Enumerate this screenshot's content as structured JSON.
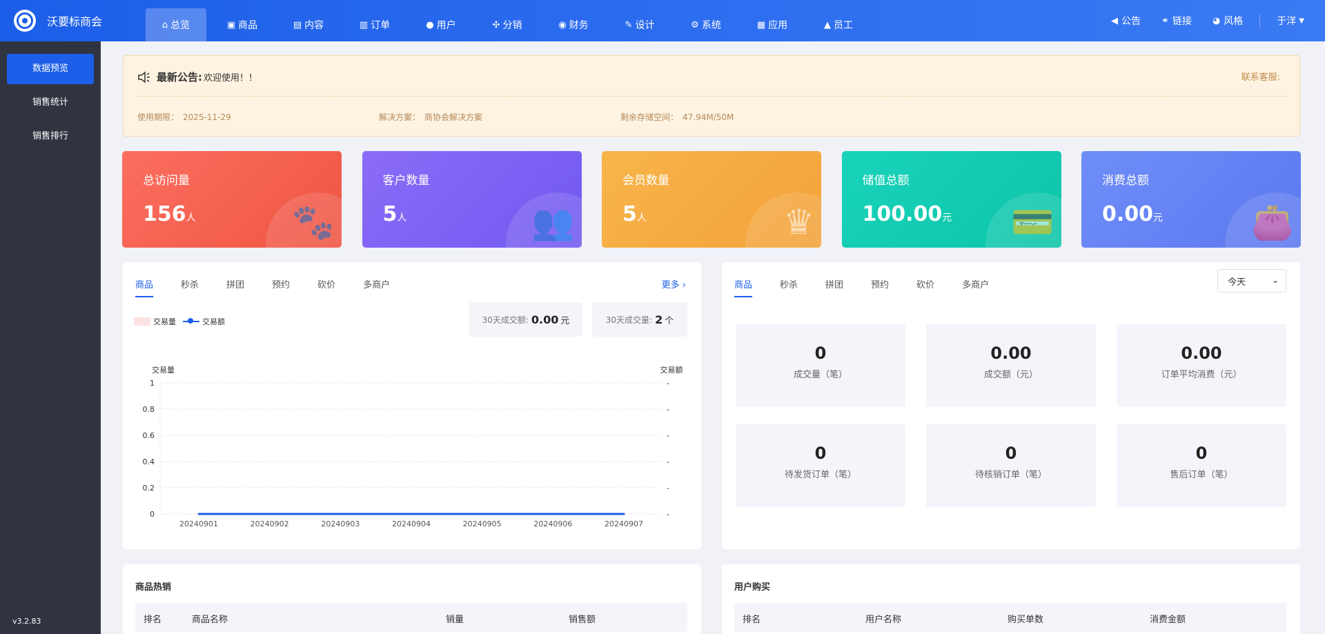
{
  "brand": {
    "name": "沃要标商会"
  },
  "nav": [
    {
      "label": "总览",
      "icon": "⌂",
      "icon_name": "home-icon",
      "active": true
    },
    {
      "label": "商品",
      "icon": "▣",
      "icon_name": "bag-icon"
    },
    {
      "label": "内容",
      "icon": "▤",
      "icon_name": "document-icon"
    },
    {
      "label": "订单",
      "icon": "▥",
      "icon_name": "clipboard-icon"
    },
    {
      "label": "用户",
      "icon": "●",
      "icon_name": "user-icon"
    },
    {
      "label": "分销",
      "icon": "✣",
      "icon_name": "network-icon"
    },
    {
      "label": "财务",
      "icon": "◉",
      "icon_name": "money-bag-icon"
    },
    {
      "label": "设计",
      "icon": "✎",
      "icon_name": "brush-icon"
    },
    {
      "label": "系统",
      "icon": "⚙",
      "icon_name": "gear-icon"
    },
    {
      "label": "应用",
      "icon": "▦",
      "icon_name": "grid-icon"
    },
    {
      "label": "员工",
      "icon": "▲",
      "icon_name": "lock-icon"
    }
  ],
  "topright": {
    "notice": "公告",
    "link": "链接",
    "style": "风格",
    "user": "于洋"
  },
  "sidebar": {
    "items": [
      "数据预览",
      "销售统计",
      "销售排行"
    ],
    "version": "v3.2.83"
  },
  "notice": {
    "title": "最新公告:",
    "text": "欢迎使用！！",
    "contact": "联系客服:",
    "expire_label": "使用期限：",
    "expire_value": "2025-11-29",
    "solution_label": "解决方案：",
    "solution_value": "商协会解决方案",
    "storage_label": "剩余存储空间：",
    "storage_value": "47.94M/50M"
  },
  "stats": [
    {
      "title": "总访问量",
      "value": "156",
      "unit": "人",
      "icon": "🐾",
      "icon_name": "paw-icon",
      "color1": "#fb6e5f",
      "color2": "#ef5542"
    },
    {
      "title": "客户数量",
      "value": "5",
      "unit": "人",
      "icon": "👥",
      "icon_name": "users-icon",
      "color1": "#8b6cf8",
      "color2": "#7258f0"
    },
    {
      "title": "会员数量",
      "value": "5",
      "unit": "人",
      "icon": "♛",
      "icon_name": "crown-icon",
      "color1": "#f8b54a",
      "color2": "#f3a23a"
    },
    {
      "title": "储值总额",
      "value": "100.00",
      "unit": "元",
      "icon": "💳",
      "icon_name": "card-icon",
      "color1": "#19d3bb",
      "color2": "#0cc4a8"
    },
    {
      "title": "消费总额",
      "value": "0.00",
      "unit": "元",
      "icon": "👛",
      "icon_name": "wallet-icon",
      "color1": "#6f8ef8",
      "color2": "#5b78f0"
    }
  ],
  "left_panel": {
    "tabs": [
      "商品",
      "秒杀",
      "拼团",
      "预约",
      "砍价",
      "多商户"
    ],
    "more": "更多 ›",
    "kpi1_label": "30天成交额:",
    "kpi1_value": "0.00",
    "kpi1_unit": "元",
    "kpi2_label": "30天成交量:",
    "kpi2_value": "2",
    "kpi2_unit": "个",
    "legend_bar": "交易量",
    "legend_line": "交易额"
  },
  "chart_data": {
    "type": "line",
    "x": [
      "20240901",
      "20240902",
      "20240903",
      "20240904",
      "20240905",
      "20240906",
      "20240907"
    ],
    "series": [
      {
        "name": "交易额",
        "values": [
          0,
          0,
          0,
          0,
          0,
          0,
          0
        ]
      }
    ],
    "ylabel": "交易量",
    "y2label": "交易额",
    "ylim": [
      0,
      1
    ],
    "yticks": [
      "0",
      "0.2",
      "0.4",
      "0.6",
      "0.8",
      "1"
    ],
    "y2ticks": [
      "-",
      "-",
      "-",
      "-",
      "-",
      "-"
    ],
    "grid": true,
    "line_color": "#1c5ee8"
  },
  "right_panel": {
    "tabs": [
      "商品",
      "秒杀",
      "拼团",
      "预约",
      "砍价",
      "多商户"
    ],
    "select": "今天",
    "metrics": [
      {
        "value": "0",
        "label": "成交量（笔）"
      },
      {
        "value": "0.00",
        "label": "成交额（元）"
      },
      {
        "value": "0.00",
        "label": "订单平均消费（元）"
      },
      {
        "value": "0",
        "label": "待发货订单（笔）"
      },
      {
        "value": "0",
        "label": "待核销订单（笔）"
      },
      {
        "value": "0",
        "label": "售后订单（笔）"
      }
    ]
  },
  "hot_products": {
    "title": "商品热销",
    "headers": [
      "排名",
      "商品名称",
      "销量",
      "销售额"
    ]
  },
  "user_purchase": {
    "title": "用户购买",
    "headers": [
      "排名",
      "用户名称",
      "购买单数",
      "消费金额"
    ]
  }
}
